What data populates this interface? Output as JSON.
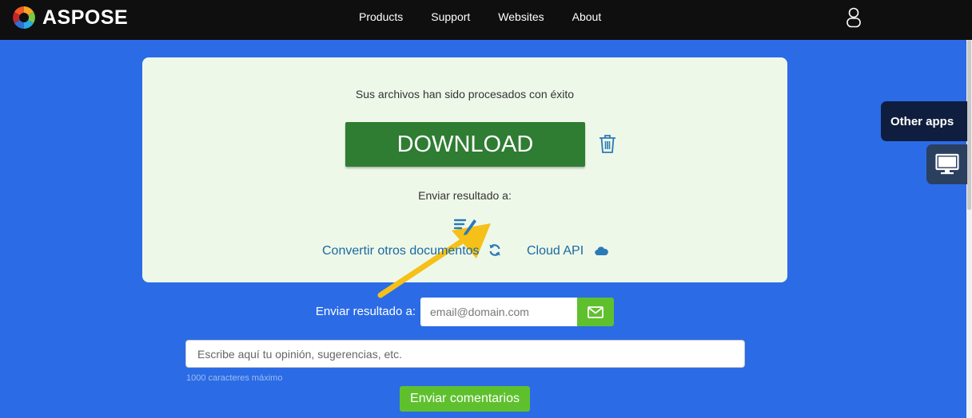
{
  "header": {
    "brand": "ASPOSE",
    "nav": [
      {
        "label": "Products"
      },
      {
        "label": "Support"
      },
      {
        "label": "Websites"
      },
      {
        "label": "About"
      }
    ]
  },
  "side": {
    "other_apps": "Other apps"
  },
  "result_card": {
    "success_message": "Sus archivos han sido procesados con éxito",
    "download_label": "DOWNLOAD",
    "send_result_label": "Enviar resultado a:",
    "convert_other_label": "Convertir otros documentos",
    "cloud_api_label": "Cloud API"
  },
  "email_form": {
    "label": "Enviar resultado a:",
    "placeholder": "email@domain.com"
  },
  "feedback": {
    "placeholder": "Escribe aquí tu opinión, sugerencias, etc.",
    "char_limit": "1000 caracteres máximo",
    "submit_label": "Enviar comentarios"
  },
  "colors": {
    "background": "#2b6be6",
    "topbar": "#0f0f0f",
    "card": "#eef8e9",
    "download": "#2e7d32",
    "accent_green": "#5fc02e",
    "link": "#1a6aa0",
    "arrow": "#f5c018"
  }
}
